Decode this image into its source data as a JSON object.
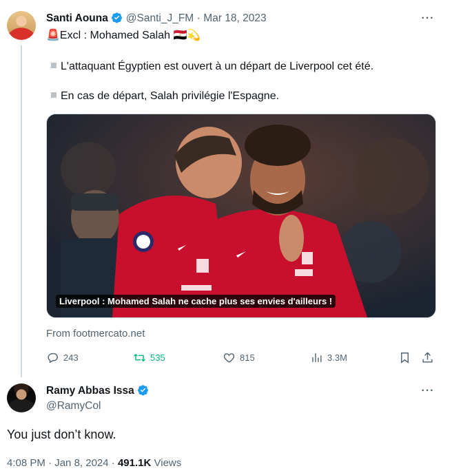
{
  "tweet1": {
    "name": "Santi Aouna",
    "handle": "@Santi_J_FM",
    "date": "Mar 18, 2023",
    "dot": "·",
    "headline_emoji": "🚨",
    "headline": "Excl : Mohamed Salah",
    "headline_flag": "🇪🇬",
    "headline_spark": "💫",
    "point1": "L'attaquant Égyptien est ouvert à un départ de Liverpool cet été.",
    "point2": "En cas de départ, Salah privilégie l'Espagne.",
    "card_caption": "Liverpool : Mohamed Salah ne cache plus ses envies d'ailleurs !",
    "card_source": "From footmercato.net",
    "replies": "243",
    "retweets": "535",
    "likes": "815",
    "views": "3.3M"
  },
  "tweet2": {
    "name": "Ramy Abbas Issa",
    "handle": "@RamyCol",
    "text": "You just don’t know.",
    "time": "4:08 PM",
    "date": "Jan 8, 2024",
    "dot": "·",
    "views_count": "491.1K",
    "views_label": "Views"
  },
  "colors": {
    "verified": "#1d9bf0",
    "retweet_active": "#00ba7c",
    "secondary_text": "#536471",
    "liverpool_red": "#c8102e"
  },
  "icons": [
    "verified-badge-icon",
    "more-icon",
    "reply-icon",
    "retweet-icon",
    "like-icon",
    "views-icon",
    "bookmark-icon",
    "share-icon"
  ]
}
